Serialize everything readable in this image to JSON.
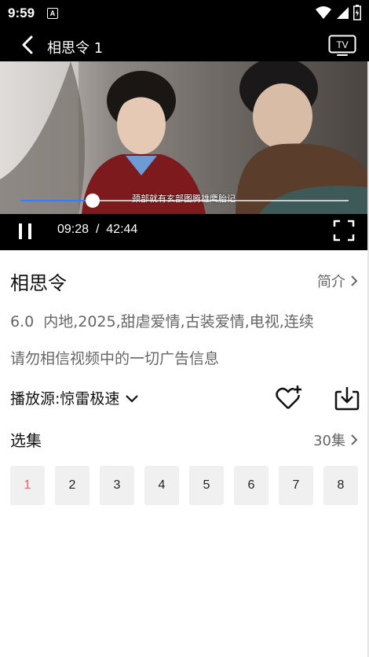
{
  "status_bar": {
    "time": "9:59",
    "notification_icon": "A",
    "icons": [
      "wifi-icon",
      "signal-icon",
      "battery-icon"
    ]
  },
  "top_bar": {
    "title": "相思令 1",
    "icons": [
      "back-icon",
      "tv-cast-icon"
    ],
    "tv_label": "TV"
  },
  "player": {
    "subtitle": "颈部就有玄部图腾雄鹰胎记",
    "current_time": "09:28",
    "separator": "/",
    "total_time": "42:44",
    "progress": 0.221,
    "progress_color": "#3b7bff",
    "icons": [
      "pause-icon",
      "fullscreen-icon"
    ]
  },
  "detail": {
    "title": "相思令",
    "intro_label": "简介",
    "rating": "6.0",
    "tags": "内地,2025,甜虐爱情,古装爱情,电视,连续",
    "warning": "请勿相信视频中的一切广告信息",
    "source_label": "播放源:",
    "source_value": "惊雷极速",
    "icons": [
      "favorite-add-icon",
      "download-icon",
      "chevron-right-icon",
      "chevron-down-icon"
    ]
  },
  "episodes": {
    "label": "选集",
    "count": "30集",
    "items": [
      "1",
      "2",
      "3",
      "4",
      "5",
      "6",
      "7",
      "8"
    ],
    "active_index": 0,
    "active_color": "#f25b5b"
  }
}
